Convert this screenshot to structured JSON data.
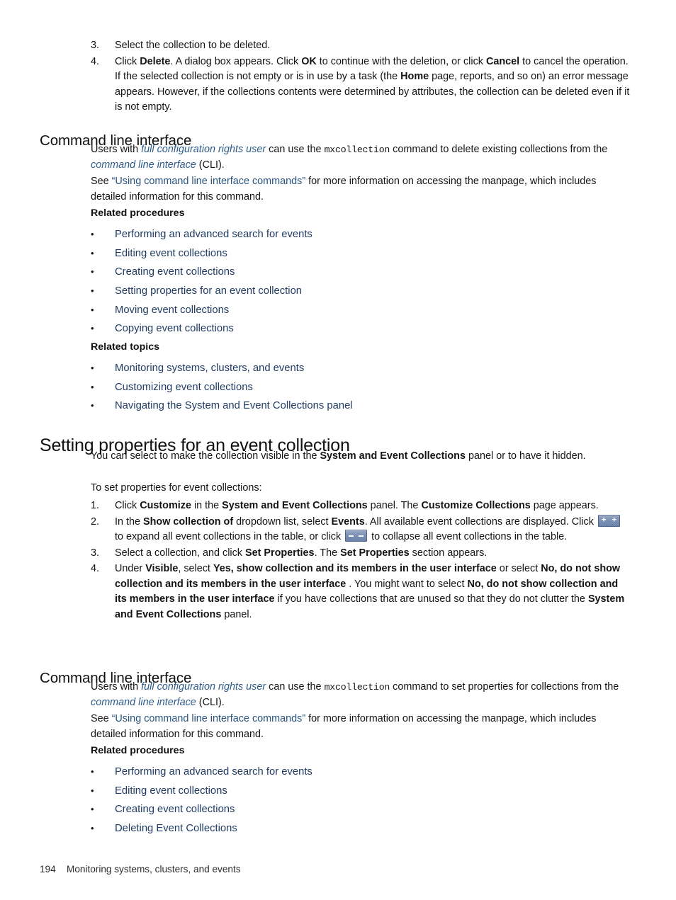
{
  "page": {
    "footer_page_number": "194",
    "footer_title": "Monitoring systems, clusters, and events",
    "link_color": "#1f3b63",
    "italic_link_color": "#2e5c8a",
    "doc_link_color": "#27547f",
    "text_color": "#141414"
  },
  "top_steps": {
    "items": [
      {
        "num": "3.",
        "text_parts": [
          {
            "t": "Select the collection to be deleted.",
            "style": "normal"
          }
        ]
      },
      {
        "num": "4.",
        "text_parts": [
          {
            "t": "Click ",
            "style": "normal"
          },
          {
            "t": "Delete",
            "style": "bold"
          },
          {
            "t": ". A dialog box appears. Click ",
            "style": "normal"
          },
          {
            "t": "OK",
            "style": "bold"
          },
          {
            "t": " to continue with the deletion, or click ",
            "style": "normal"
          },
          {
            "t": "Cancel",
            "style": "bold"
          },
          {
            "t": " to cancel the operation. If the selected collection is not empty or is in use by a task (the ",
            "style": "normal"
          },
          {
            "t": "Home",
            "style": "bold"
          },
          {
            "t": " page, reports, and so on) an error message appears. However, if the collections contents were determined by attributes, the collection can be deleted even if it is not empty.",
            "style": "normal"
          }
        ]
      }
    ]
  },
  "cli_section_1": {
    "heading": "Command line interface",
    "para1_parts": [
      {
        "t": "Users with ",
        "style": "normal"
      },
      {
        "t": "full configuration rights user",
        "style": "ital-link"
      },
      {
        "t": " can use the ",
        "style": "normal"
      },
      {
        "t": "mxcollection",
        "style": "mono"
      },
      {
        "t": " command to delete existing collections from the ",
        "style": "normal"
      },
      {
        "t": "command line interface",
        "style": "ital-link"
      },
      {
        "t": " (CLI).",
        "style": "normal"
      }
    ],
    "para2_parts": [
      {
        "t": "See ",
        "style": "normal"
      },
      {
        "t": "“Using command line interface commands”",
        "style": "doc-link"
      },
      {
        "t": " for more information on accessing the manpage, which includes detailed information for this command.",
        "style": "normal"
      }
    ],
    "related_procedures_heading": "Related procedures",
    "related_procedures": [
      "Performing an advanced search for events",
      "Editing event collections",
      "Creating event collections",
      "Setting properties for an event collection",
      "Moving event collections",
      "Copying event collections"
    ],
    "related_topics_heading": "Related topics",
    "related_topics": [
      "Monitoring systems, clusters, and events",
      "Customizing event collections",
      "Navigating the System and Event Collections panel"
    ]
  },
  "main_section": {
    "heading": "Setting properties for an event collection",
    "intro_parts": [
      {
        "t": "You can select to make the collection visible in the ",
        "style": "normal"
      },
      {
        "t": "System and Event Collections",
        "style": "bold"
      },
      {
        "t": " panel or to have it hidden.",
        "style": "normal"
      }
    ],
    "lead_in": "To set properties for event collections:",
    "steps": [
      {
        "num": "1.",
        "text_parts": [
          {
            "t": "Click ",
            "style": "normal"
          },
          {
            "t": "Customize",
            "style": "bold"
          },
          {
            "t": " in the ",
            "style": "normal"
          },
          {
            "t": "System and Event Collections",
            "style": "bold"
          },
          {
            "t": " panel. The ",
            "style": "normal"
          },
          {
            "t": "Customize Collections",
            "style": "bold"
          },
          {
            "t": " page appears.",
            "style": "normal"
          }
        ]
      },
      {
        "num": "2.",
        "text_parts": [
          {
            "t": "In the ",
            "style": "normal"
          },
          {
            "t": "Show collection of",
            "style": "bold"
          },
          {
            "t": " dropdown list, select ",
            "style": "normal"
          },
          {
            "t": "Events",
            "style": "bold"
          },
          {
            "t": ". All available event collections are displayed. Click ",
            "style": "normal"
          },
          {
            "t": "expand-all-icon",
            "style": "icon-plus"
          },
          {
            "t": " to expand all event collections in the table, or click ",
            "style": "normal"
          },
          {
            "t": "collapse-all-icon",
            "style": "icon-minus"
          },
          {
            "t": " to collapse all event collections in the table.",
            "style": "normal"
          }
        ]
      },
      {
        "num": "3.",
        "text_parts": [
          {
            "t": "Select a collection, and click ",
            "style": "normal"
          },
          {
            "t": "Set Properties",
            "style": "bold"
          },
          {
            "t": ". The ",
            "style": "normal"
          },
          {
            "t": "Set Properties",
            "style": "bold"
          },
          {
            "t": " section appears.",
            "style": "normal"
          }
        ]
      },
      {
        "num": "4.",
        "text_parts": [
          {
            "t": "Under ",
            "style": "normal"
          },
          {
            "t": "Visible",
            "style": "bold"
          },
          {
            "t": ", select ",
            "style": "normal"
          },
          {
            "t": "Yes, show collection and its members in the user interface",
            "style": "bold"
          },
          {
            "t": "  or select ",
            "style": "normal"
          },
          {
            "t": "No, do not show collection and its members in the user interface",
            "style": "bold"
          },
          {
            "t": " . You might want to select ",
            "style": "normal"
          },
          {
            "t": "No, do not show collection and its members in the user interface",
            "style": "bold"
          },
          {
            "t": "  if you have collections that are unused so that they do not clutter the ",
            "style": "normal"
          },
          {
            "t": "System and Event Collections",
            "style": "bold"
          },
          {
            "t": " panel.",
            "style": "normal"
          }
        ]
      }
    ]
  },
  "cli_section_2": {
    "heading": "Command line interface",
    "para1_parts": [
      {
        "t": "Users with ",
        "style": "normal"
      },
      {
        "t": "full configuration rights user",
        "style": "ital-link"
      },
      {
        "t": " can use the ",
        "style": "normal"
      },
      {
        "t": "mxcollection",
        "style": "mono"
      },
      {
        "t": " command to set properties for collections from the ",
        "style": "normal"
      },
      {
        "t": "command line interface",
        "style": "ital-link"
      },
      {
        "t": " (CLI).",
        "style": "normal"
      }
    ],
    "para2_parts": [
      {
        "t": "See ",
        "style": "normal"
      },
      {
        "t": "“Using command line interface commands”",
        "style": "doc-link"
      },
      {
        "t": " for more information on accessing the manpage, which includes detailed information for this command.",
        "style": "normal"
      }
    ],
    "related_procedures_heading": "Related procedures",
    "related_procedures": [
      "Performing an advanced search for events",
      "Editing event collections",
      "Creating event collections",
      "Deleting Event Collections"
    ]
  },
  "bullet_glyph": "•"
}
